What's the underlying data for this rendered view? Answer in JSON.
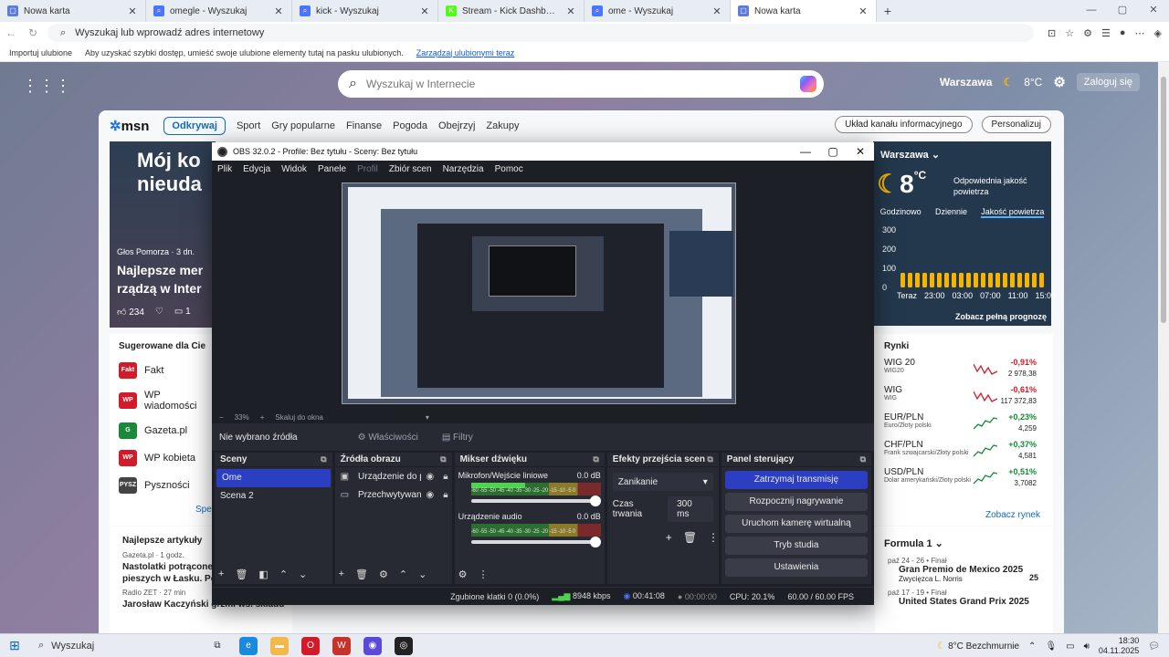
{
  "browser": {
    "tabs": [
      {
        "title": "Nowa karta",
        "active": false,
        "color": "#5d7bd8",
        "glyph": "▢"
      },
      {
        "title": "omegle - Wyszukaj",
        "active": false,
        "color": "#4b74ff",
        "glyph": "⌕"
      },
      {
        "title": "kick - Wyszukaj",
        "active": false,
        "color": "#4b74ff",
        "glyph": "⌕"
      },
      {
        "title": "Stream - Kick Dashboard",
        "active": false,
        "color": "#53fc18",
        "glyph": "K"
      },
      {
        "title": "ome - Wyszukaj",
        "active": false,
        "color": "#4b74ff",
        "glyph": "⌕"
      },
      {
        "title": "Nowa karta",
        "active": true,
        "color": "#5d7bd8",
        "glyph": "▢"
      }
    ],
    "address_placeholder": "Wyszukaj lub wprowadź adres internetowy",
    "favorites": {
      "import": "Importuj ulubione",
      "hint": "Aby uzyskać szybki dostęp, umieść swoje ulubione elementy tutaj na pasku ulubionych.",
      "manage_link": "Zarządzaj ulubionymi teraz"
    }
  },
  "msn": {
    "search_placeholder": "Wyszukaj w Internecie",
    "location": "Warszawa",
    "temp_small": "8°C",
    "login": "Zaloguj się",
    "logo": "msn",
    "nav": [
      "Odkrywaj",
      "Sport",
      "Gry popularne",
      "Finanse",
      "Pogoda",
      "Obejrzyj",
      "Zakupy"
    ],
    "feed_layout": "Układ kanału informacyjnego",
    "personalize": "Personalizuj",
    "hero": {
      "big": "Mój ko\nnieuda",
      "source": "Głos Pomorza · 3 dn.",
      "headline": "Najlepsze mer\nrządzą w Inter",
      "likes": "234",
      "comments": "1"
    },
    "suggested": {
      "title": "Sugerowane dla Cie",
      "items": [
        {
          "label": "Fakt",
          "logo": "Fakt",
          "color": "#d11a2a"
        },
        {
          "label": "WP wiadomości",
          "logo": "WP",
          "color": "#d11a2a"
        },
        {
          "label": "Gazeta.pl",
          "logo": "G",
          "color": "#1a8a3a"
        },
        {
          "label": "WP kobieta",
          "logo": "WP",
          "color": "#d11a2a"
        },
        {
          "label": "Pyszności",
          "logo": "PYSZ",
          "color": "#444"
        }
      ],
      "more": "Sperson"
    },
    "articles": {
      "title": "Najlepsze artykuły",
      "items": [
        {
          "src": "Gazeta.pl · 1 godz.",
          "title": "Nastolatki potrącone na\npieszych w Łasku. Polic"
        },
        {
          "src": "Radio ZET · 27 min",
          "title": "Jarosław Kaczyński grzmi ws. składu"
        }
      ]
    },
    "weather": {
      "location": "Warszawa",
      "temp": "8",
      "unit": "°C",
      "air": "Odpowiednia jakość powietrza",
      "tabs": [
        "Godzinowo",
        "Dziennie",
        "Jakość powietrza"
      ],
      "y_ticks": [
        "300",
        "200",
        "100",
        "0"
      ],
      "hours": [
        "Teraz",
        "23:00",
        "03:00",
        "07:00",
        "11:00",
        "15:00"
      ],
      "more": "Zobacz pełną prognozę"
    },
    "markets": {
      "title": "Rynki",
      "rows": [
        {
          "name": "WIG 20",
          "desc": "WIG20",
          "pct": "-0,91%",
          "val": "2 978,38",
          "dir": "neg"
        },
        {
          "name": "WIG",
          "desc": "WIG",
          "pct": "-0,61%",
          "val": "117 372,83",
          "dir": "neg"
        },
        {
          "name": "EUR/PLN",
          "desc": "Euro/Złoty polski",
          "pct": "+0,23%",
          "val": "4,259",
          "dir": "pos"
        },
        {
          "name": "CHF/PLN",
          "desc": "Frank szwajcarski/Złoty polski",
          "pct": "+0,37%",
          "val": "4,581",
          "dir": "pos"
        },
        {
          "name": "USD/PLN",
          "desc": "Dolar amerykański/Złoty polski",
          "pct": "+0,51%",
          "val": "3,7082",
          "dir": "pos"
        }
      ],
      "more": "Zobacz rynek"
    },
    "f1": {
      "title": "Formula 1",
      "races": [
        {
          "date": "paź 24 - 26 • Finał",
          "name": "Gran Premio de Mexico 2025",
          "winner": "Zwycięzca",
          "driver": "L. Norris",
          "pts": "25"
        },
        {
          "date": "paź 17 - 19 • Finał",
          "name": "United States Grand Prix 2025"
        }
      ]
    }
  },
  "obs": {
    "title": "OBS 32.0.2 - Profile: Bez tytułu - Sceny: Bez tytułu",
    "menu": [
      "Plik",
      "Edycja",
      "Widok",
      "Panele",
      "Profil",
      "Zbiór scen",
      "Narzędzia",
      "Pomoc"
    ],
    "zoom": "33%",
    "scale": "Skaluj do okna",
    "no_source": "Nie wybrano źródła",
    "properties": "Właściwości",
    "filters": "Filtry",
    "scenes_title": "Sceny",
    "scenes": [
      "Ome",
      "Scena 2"
    ],
    "sources_title": "Źródła obrazu",
    "sources": [
      "Urządzenie do pr",
      "Przechwytywani"
    ],
    "mixer_title": "Mikser dźwięku",
    "mixer": [
      {
        "name": "Mikrofon/Wejście liniowe",
        "db": "0.0 dB",
        "level": 0.42
      },
      {
        "name": "Urządzenie audio",
        "db": "0.0 dB",
        "level": 0.0
      }
    ],
    "meter_ticks": "-60 -55 -50 -45 -40 -35 -30 -25 -20 -15 -10 -5 0",
    "transitions_title": "Efekty przejścia scen",
    "transition": "Zanikanie",
    "duration_label": "Czas trwania",
    "duration": "300 ms",
    "controls_title": "Panel sterujący",
    "controls": [
      "Zatrzymaj transmisję",
      "Rozpocznij nagrywanie",
      "Uruchom kamerę wirtualną",
      "Tryb studia",
      "Ustawienia"
    ],
    "status": {
      "dropped": "Zgubione klatki 0 (0.0%)",
      "bitrate": "8948 kbps",
      "live": "00:41:08",
      "rec": "00:00:00",
      "cpu": "CPU: 20.1%",
      "fps": "60.00 / 60.00 FPS"
    }
  },
  "taskbar": {
    "search": "Wyszukaj",
    "weather": "8°C  Bezchmurnie",
    "time": "18:30",
    "date": "04.11.2025"
  }
}
